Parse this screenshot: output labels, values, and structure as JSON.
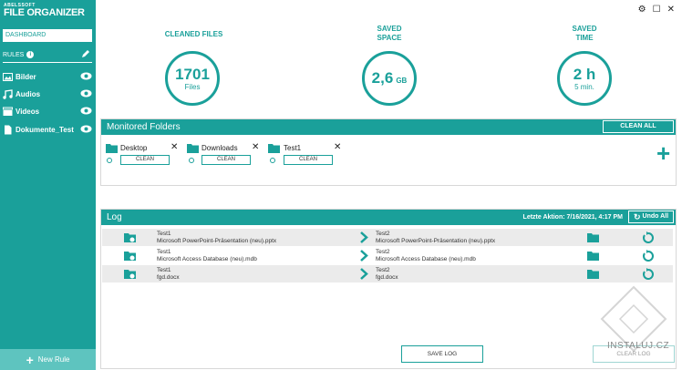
{
  "app": {
    "logo_small": "ABELSSOFT",
    "logo_big": "FILE ORGANIZER"
  },
  "sidebar": {
    "dashboard": "DASHBOARD",
    "rules_label": "RULES",
    "info": "i",
    "items": [
      {
        "label": "Bilder",
        "icon": "image-icon"
      },
      {
        "label": "Audios",
        "icon": "music-icon"
      },
      {
        "label": "Videos",
        "icon": "video-icon"
      },
      {
        "label": "Dokumente_Test",
        "icon": "document-icon"
      }
    ],
    "new_rule": "New Rule"
  },
  "window": {
    "settings": "⚙",
    "maximize": "☐",
    "close": "✕"
  },
  "stats": {
    "cleaned": {
      "label1": "CLEANED FILES",
      "label2": "",
      "value": "1701",
      "unit": "Files"
    },
    "space": {
      "label1": "SAVED",
      "label2": "SPACE",
      "value": "2,6",
      "unit": "GB"
    },
    "time": {
      "label1": "SAVED",
      "label2": "TIME",
      "value": "2 h",
      "unit": "5 min."
    }
  },
  "monitored": {
    "title": "Monitored Folders",
    "clean_all": "CLEAN ALL",
    "folders": [
      {
        "name": "Desktop",
        "clean": "CLEAN"
      },
      {
        "name": "Downloads",
        "clean": "CLEAN"
      },
      {
        "name": "Test1",
        "clean": "CLEAN"
      }
    ],
    "add": "+"
  },
  "log": {
    "title": "Log",
    "last_action": "Letzte Aktion: 7/16/2021, 4:17 PM",
    "undo_all": "Undo All",
    "rows": [
      {
        "src_folder": "Test1",
        "src_file": "Microsoft PowerPoint-Präsentation (neu).pptx",
        "dst_folder": "Test2",
        "dst_file": "Microsoft PowerPoint-Präsentation (neu).pptx"
      },
      {
        "src_folder": "Test1",
        "src_file": "Microsoft Access Database (neu).mdb",
        "dst_folder": "Test2",
        "dst_file": "Microsoft Access Database (neu).mdb"
      },
      {
        "src_folder": "Test1",
        "src_file": "fgd.docx",
        "dst_folder": "Test2",
        "dst_file": "fgd.docx"
      }
    ],
    "save_log": "SAVE LOG",
    "clear_log": "CLEAR LOG"
  },
  "watermark": "INSTALUJ.CZ",
  "colors": {
    "accent": "#1aa09a",
    "accent_light": "#5ec4bf"
  }
}
